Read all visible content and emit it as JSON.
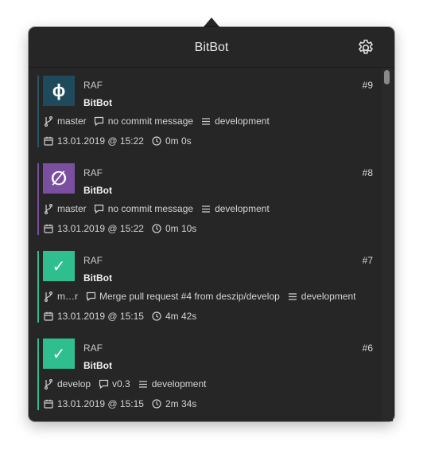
{
  "app": {
    "title": "BitBot"
  },
  "colors": {
    "running": "#1f4a5c",
    "cancelled": "#7b4fa0",
    "success": "#2fbf8f",
    "running_bar": "#2c5566",
    "cancelled_bar": "#7b4fa0",
    "success_bar": "#2fbf8f"
  },
  "builds": [
    {
      "status": "running",
      "status_icon": "phi-symbol-icon",
      "glyph": "ϕ",
      "author": "RAF",
      "repo": "BitBot",
      "number": "#9",
      "branch": "master",
      "commit_message": "no commit message",
      "pipeline": "development",
      "date": "13.01.2019 @ 15:22",
      "duration": "0m 0s"
    },
    {
      "status": "cancelled",
      "status_icon": "empty-set-icon",
      "glyph": "∅",
      "author": "RAF",
      "repo": "BitBot",
      "number": "#8",
      "branch": "master",
      "commit_message": "no commit message",
      "pipeline": "development",
      "date": "13.01.2019 @ 15:22",
      "duration": "0m 10s"
    },
    {
      "status": "success",
      "status_icon": "checkmark-icon",
      "glyph": "✓",
      "author": "RAF",
      "repo": "BitBot",
      "number": "#7",
      "branch": "m…r",
      "commit_message": "Merge pull request #4 from deszip/develop",
      "pipeline": "development",
      "date": "13.01.2019 @ 15:15",
      "duration": "4m 42s"
    },
    {
      "status": "success",
      "status_icon": "checkmark-icon",
      "glyph": "✓",
      "author": "RAF",
      "repo": "BitBot",
      "number": "#6",
      "branch": "develop",
      "commit_message": "v0.3",
      "pipeline": "development",
      "date": "13.01.2019 @ 15:15",
      "duration": "2m 34s"
    }
  ]
}
